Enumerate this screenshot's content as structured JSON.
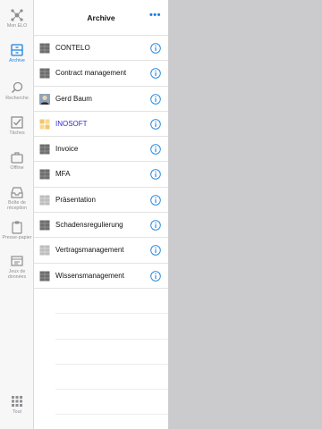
{
  "colors": {
    "accent": "#1a82e2",
    "rail_bg": "#f7f7f7",
    "detail_bg": "#cbcbcd",
    "link": "#2b2bd6"
  },
  "rail": {
    "items": [
      {
        "label": "Mon ELO",
        "icon": "network-icon",
        "active": false
      },
      {
        "label": "Archive",
        "icon": "archive-icon",
        "active": true
      },
      {
        "label": "Recherche",
        "icon": "search-icon",
        "active": false
      },
      {
        "label": "Tâches",
        "icon": "tasks-checkbox-icon",
        "active": false
      },
      {
        "label": "Offline",
        "icon": "briefcase-icon",
        "active": false
      },
      {
        "label": "Boîte de réception",
        "icon": "inbox-tray-icon",
        "active": false
      },
      {
        "label": "Presse-papier",
        "icon": "clipboard-icon",
        "active": false
      },
      {
        "label": "Jeux de données",
        "icon": "datasets-icon",
        "active": false
      },
      {
        "label": "Tout",
        "icon": "grid-icon",
        "active": false
      }
    ]
  },
  "header": {
    "title": "Archive",
    "more": "•••"
  },
  "list": {
    "items": [
      {
        "label": "CONTELO",
        "thumb": "cabinet-icon",
        "link": false
      },
      {
        "label": "Contract management",
        "thumb": "cabinet-icon",
        "link": false
      },
      {
        "label": "Gerd Baum",
        "thumb": "person-photo-icon",
        "link": false
      },
      {
        "label": "INOSOFT",
        "thumb": "yellow-folder-icon",
        "link": true
      },
      {
        "label": "Invoice",
        "thumb": "cabinet-icon",
        "link": false
      },
      {
        "label": "MFA",
        "thumb": "cabinet-icon",
        "link": false
      },
      {
        "label": "Präsentation",
        "thumb": "cabinet-light-icon",
        "link": false
      },
      {
        "label": "Schadensregulierung",
        "thumb": "cabinet-icon",
        "link": false
      },
      {
        "label": "Vertragsmanagement",
        "thumb": "cabinet-light-icon",
        "link": false
      },
      {
        "label": "Wissensmanagement",
        "thumb": "cabinet-icon",
        "link": false
      }
    ]
  }
}
